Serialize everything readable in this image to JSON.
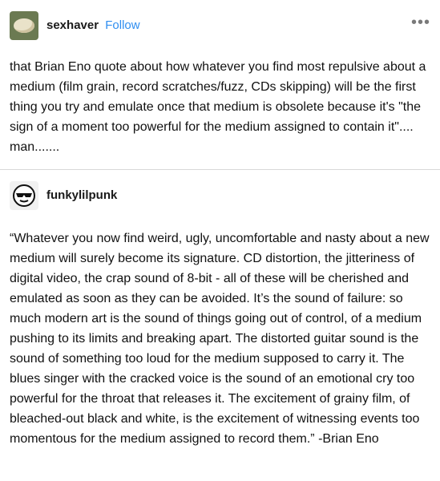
{
  "post": {
    "username": "sexhaver",
    "follow_label": "Follow",
    "more_label": "•••",
    "body": "that Brian Eno quote about how whatever you find most repulsive about a medium (film grain, record scratches/fuzz, CDs skipping) will be the first thing you try and emulate once that medium is obsolete because it's \"the sign of a moment too powerful for the medium assigned to contain it\".... man......."
  },
  "reblog": {
    "username": "funkylilpunk",
    "body": "“Whatever you now find weird, ugly, uncomfortable and nasty about a new medium will surely become its signature. CD distortion, the jitteriness of digital video, the crap sound of 8-bit - all of these will be cherished and emulated as soon as they can be avoided. It’s the sound of failure: so much modern art is the sound of things going out of control, of a medium pushing to its limits and breaking apart. The distorted guitar sound is the sound of something too loud for the medium supposed to carry it. The blues singer with the cracked voice is the sound of an emotional cry too powerful for the throat that releases it. The excitement of grainy film, of bleached-out black and white, is the excitement of witnessing events too momentous for the medium assigned to record them.” -Brian Eno"
  },
  "icons": {
    "avatar1": "bread-bun-avatar",
    "avatar2": "sunglasses-face-avatar",
    "more": "more-options-icon"
  },
  "colors": {
    "follow": "#2f8ef0",
    "divider": "#d9d9d9",
    "text": "#111111"
  }
}
